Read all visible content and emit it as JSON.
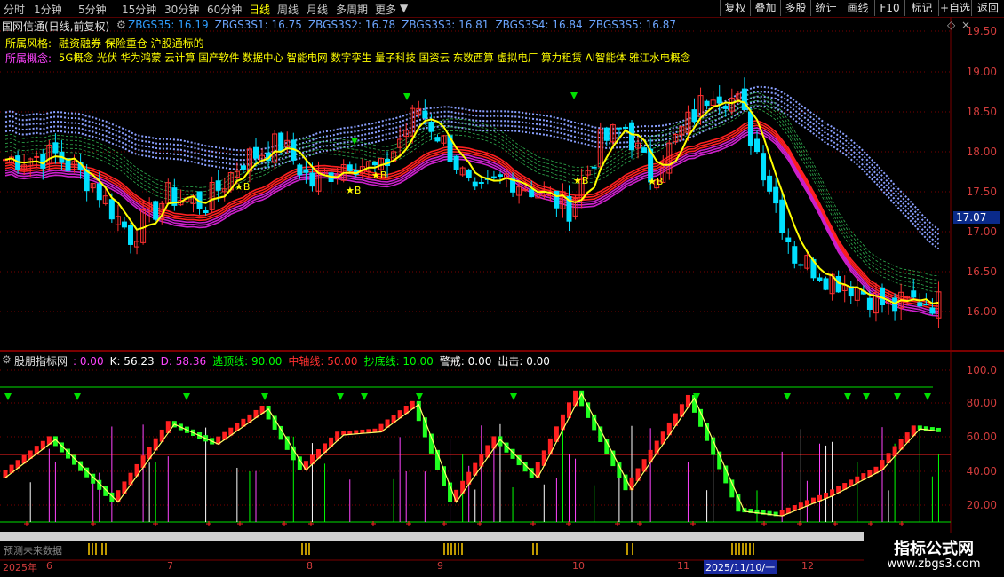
{
  "toolbar": {
    "periods": [
      "分时",
      "1分钟",
      "5分钟",
      "15分钟",
      "30分钟",
      "60分钟",
      "日线",
      "周线",
      "月线",
      "多周期",
      "更多"
    ],
    "active_period": "日线",
    "buttons": [
      "复权",
      "叠加",
      "多股",
      "统计",
      "画线",
      "F10",
      "标记",
      "+自选",
      "返回"
    ]
  },
  "main_chart": {
    "title": "国网信通(日线,前复权)",
    "indicators": [
      {
        "label": "ZBGS35: 16.19",
        "color": "#2f9fff"
      },
      {
        "label": "ZBGS3S1: 16.75",
        "color": "#6ca6ff"
      },
      {
        "label": "ZBGS3S2: 16.78",
        "color": "#6ca6ff"
      },
      {
        "label": "ZBGS3S3: 16.81",
        "color": "#6ca6ff"
      },
      {
        "label": "ZBGS3S4: 16.84",
        "color": "#6ca6ff"
      },
      {
        "label": "ZBGS3S5: 16.87",
        "color": "#6ca6ff"
      }
    ],
    "style_label": "所属风格:",
    "style_value": "融资融券 保险重仓 沪股通标的",
    "concept_label": "所属概念:",
    "concept_value": "5G概念 光伏 华为鸿蒙 云计算 国产软件 数据中心 智能电网 数字孪生 量子科技 国资云 东数西算 虚拟电厂 算力租赁 AI智能体 雅江水电概念",
    "price_axis": [
      "19.50",
      "19.00",
      "18.50",
      "18.00",
      "17.50",
      "17.00",
      "16.50",
      "16.00"
    ],
    "current_price": "17.07",
    "buy_mark": "★B"
  },
  "sub_chart": {
    "title": "股朋指标网",
    "items": [
      {
        "label": ": 0.00",
        "color": "#ff44ff"
      },
      {
        "label": "K: 56.23",
        "color": "#ffffff"
      },
      {
        "label": "D: 58.36",
        "color": "#ff44ff"
      },
      {
        "label": "逃顶线: 90.00",
        "color": "#00ff00"
      },
      {
        "label": "中轴线: 50.00",
        "color": "#ff3030"
      },
      {
        "label": "抄底线: 10.00",
        "color": "#00ff00"
      },
      {
        "label": "警戒: 0.00",
        "color": "#ffffff"
      },
      {
        "label": "出击: 0.00",
        "color": "#ffffff"
      }
    ],
    "axis": [
      "100.0",
      "80.00",
      "60.00",
      "40.00",
      "20.00"
    ],
    "future_label": "预测未来数据"
  },
  "dates": [
    {
      "label": "2025年"
    },
    {
      "label": "6"
    },
    {
      "label": "7"
    },
    {
      "label": "8"
    },
    {
      "label": "9"
    },
    {
      "label": "10"
    },
    {
      "label": "11"
    },
    {
      "label": "2025/11/10/一"
    },
    {
      "label": "12"
    }
  ],
  "watermark": {
    "line1": "指标公式网",
    "line2": "www.zbgs3.com"
  },
  "colors": {
    "up": "#ff3030",
    "down": "#00e0ff",
    "grid": "#7a0000",
    "axis": "#d23c3c",
    "yellow": "#ffff00"
  }
}
